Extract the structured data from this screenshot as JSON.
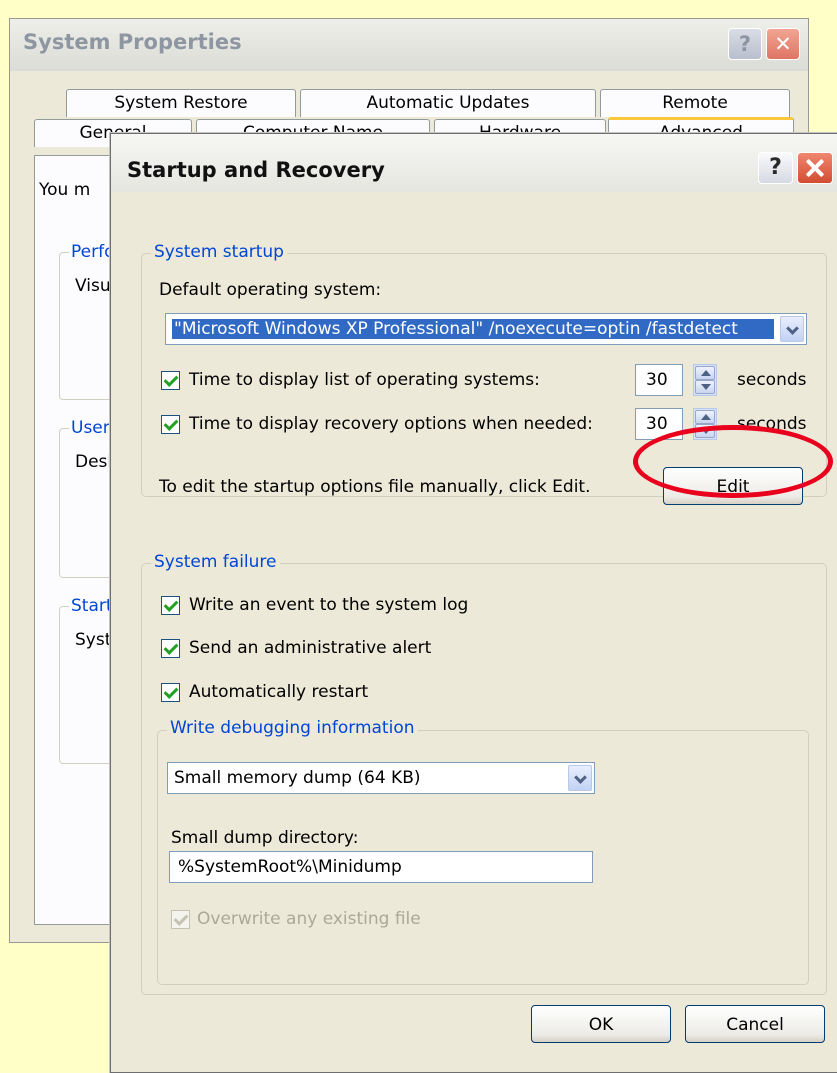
{
  "system_properties": {
    "title": "System Properties",
    "help": "?",
    "tabs_back": [
      "System Restore",
      "Automatic Updates",
      "Remote"
    ],
    "tabs_front": [
      "General",
      "Computer Name",
      "Hardware",
      "Advanced"
    ],
    "intro_text": "You m",
    "groups": [
      {
        "legend": "Perfo",
        "text": "Visu"
      },
      {
        "legend": "User",
        "text": "Desk"
      },
      {
        "legend": "Start",
        "text": "Syst"
      }
    ]
  },
  "dialog": {
    "title": "Startup and Recovery",
    "help": "?",
    "system_startup": {
      "legend": "System startup",
      "default_os_label": "Default operating system:",
      "default_os_value": "\"Microsoft Windows XP Professional\" /noexecute=optin /fastdetect",
      "time_list_label": "Time to display list of operating systems:",
      "time_list_checked": true,
      "time_list_value": "30",
      "time_recovery_label": "Time to display recovery options when needed:",
      "time_recovery_checked": true,
      "time_recovery_value": "30",
      "seconds_label": "seconds",
      "edit_hint": "To edit the startup options file manually, click Edit.",
      "edit_button": "Edit"
    },
    "system_failure": {
      "legend": "System failure",
      "write_event_label": "Write an event to the system log",
      "write_event_checked": true,
      "send_alert_label": "Send an administrative alert",
      "send_alert_checked": true,
      "auto_restart_label": "Automatically restart",
      "auto_restart_checked": true,
      "debug": {
        "legend": "Write debugging information",
        "dump_type_value": "Small memory dump (64 KB)",
        "dir_label": "Small dump directory:",
        "dir_value": "%SystemRoot%\\Minidump",
        "overwrite_label": "Overwrite any existing file",
        "overwrite_checked": true,
        "overwrite_enabled": false
      }
    },
    "ok_button": "OK",
    "cancel_button": "Cancel"
  },
  "colors": {
    "background": "#ffffc8",
    "highlight": "#e8001c",
    "legend_blue": "#0046d5"
  }
}
